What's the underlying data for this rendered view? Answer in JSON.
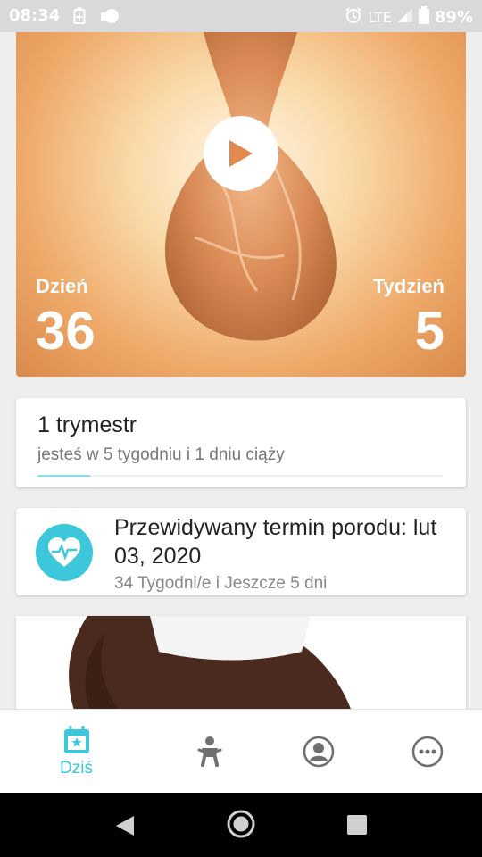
{
  "status_bar": {
    "time": "08:34",
    "network": "LTE",
    "battery": "89%"
  },
  "hero": {
    "day_label": "Dzień",
    "day_value": "36",
    "week_label": "Tydzień",
    "week_value": "5"
  },
  "trimester_card": {
    "title": "1 trymestr",
    "subtitle": "jesteś w 5 tygodniu i 1 dniu ciąży",
    "progress_fraction": 0.13
  },
  "due_card": {
    "title": "Przewidywany termin porodu: lut 03, 2020",
    "subtitle": "34 Tygodni/e i Jeszcze 5 dni",
    "icon": "heart-pulse-icon"
  },
  "bottom_nav": {
    "items": [
      {
        "label": "Dziś",
        "icon": "calendar-star-icon",
        "active": true
      },
      {
        "label": "",
        "icon": "baby-icon",
        "active": false
      },
      {
        "label": "",
        "icon": "profile-icon",
        "active": false
      },
      {
        "label": "",
        "icon": "more-icon",
        "active": false
      }
    ]
  },
  "colors": {
    "accent": "#3cc8da",
    "inactive": "#6f6f6f"
  }
}
